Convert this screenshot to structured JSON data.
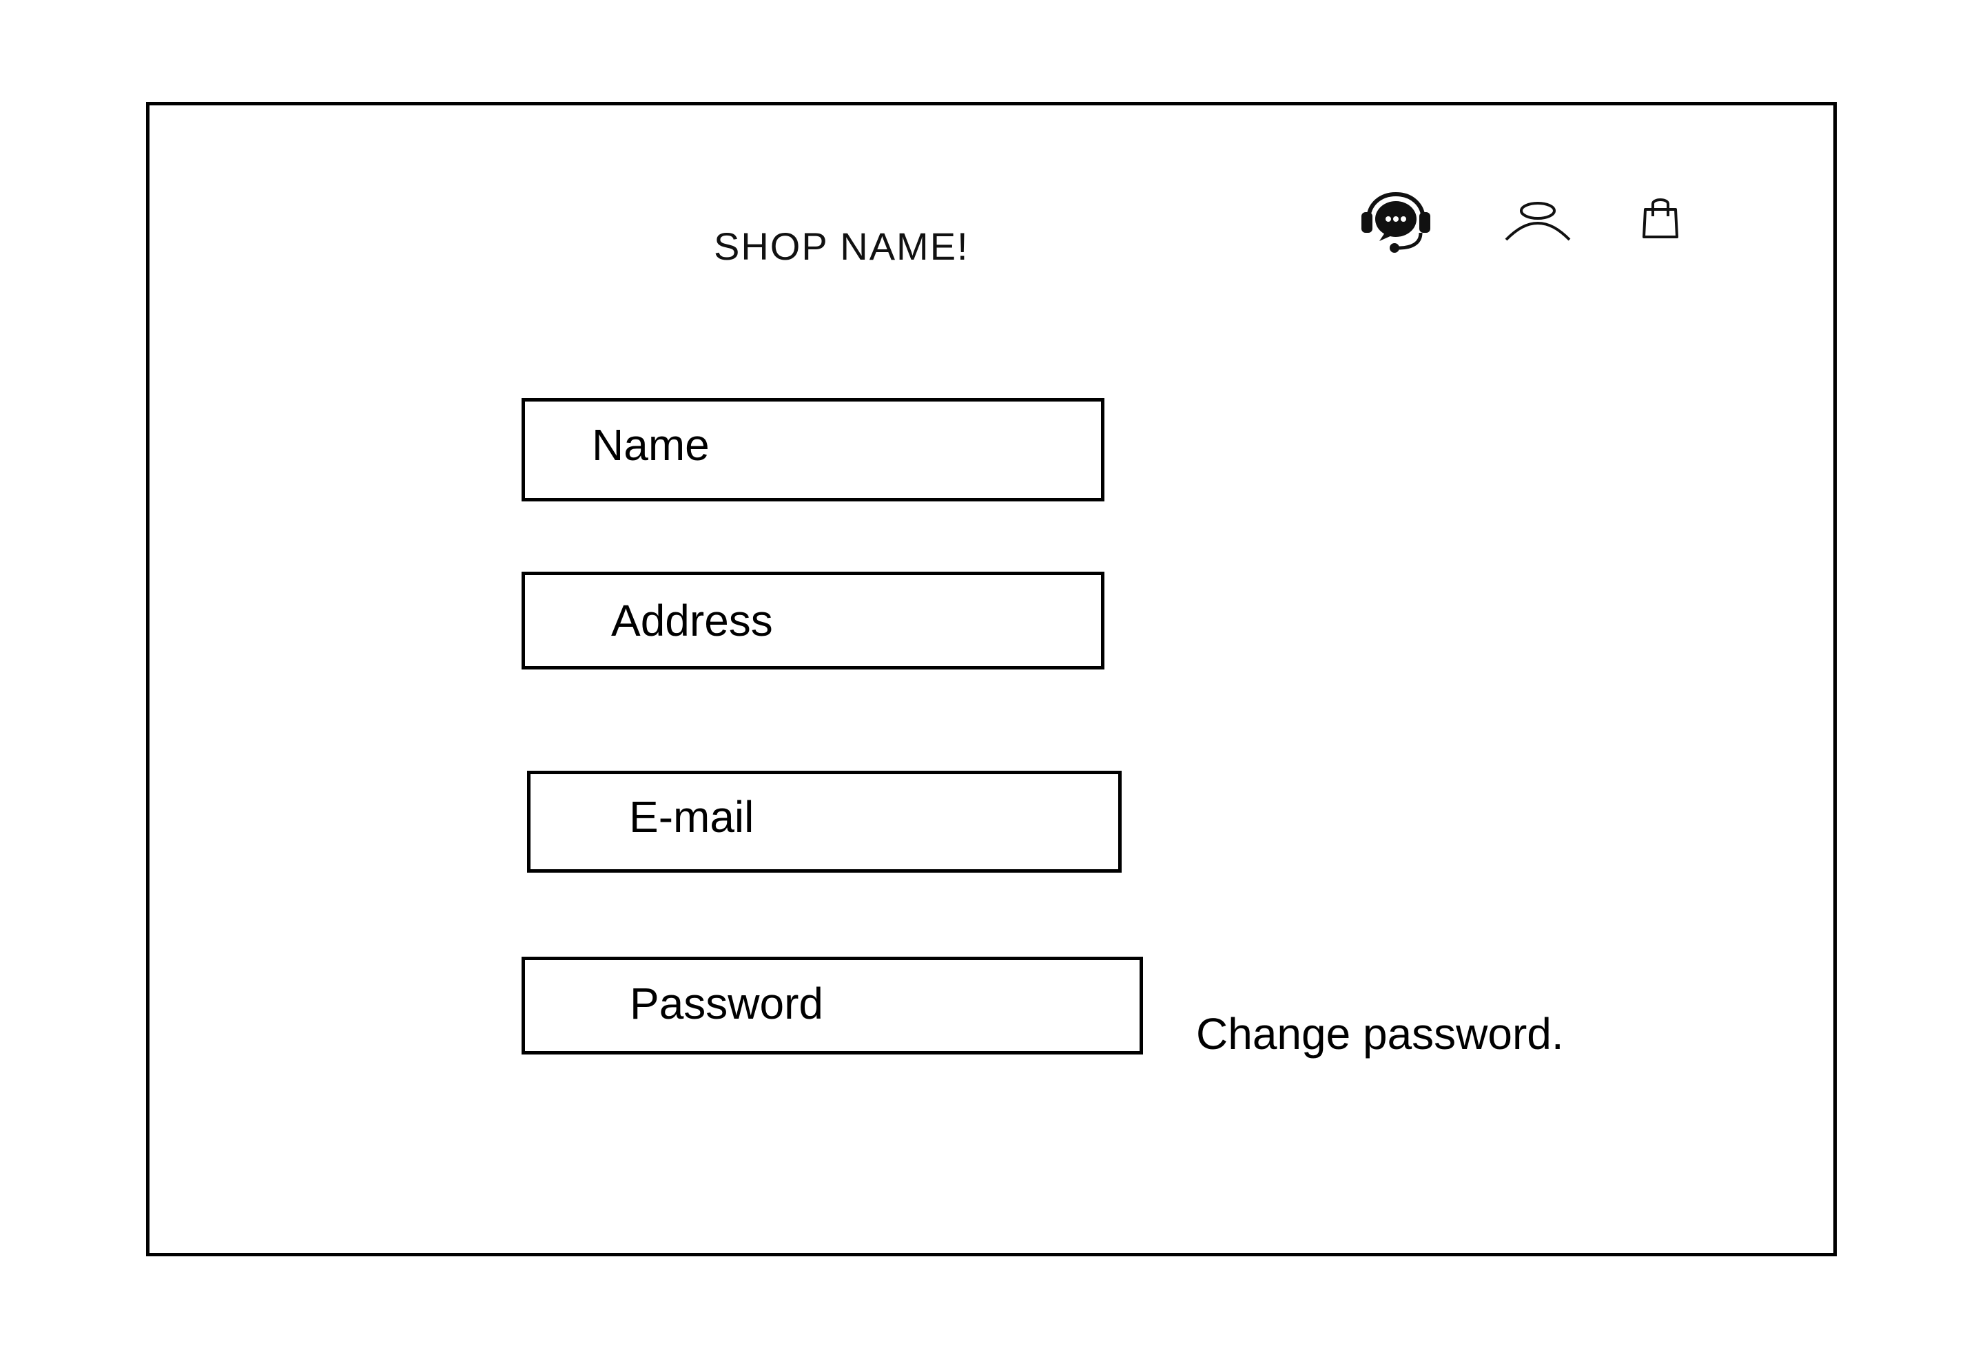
{
  "header": {
    "shop_name": "SHOP NAME!",
    "icons": [
      "support-chat-icon",
      "user-icon",
      "shopping-bag-icon"
    ]
  },
  "form": {
    "name_label": "Name",
    "address_label": "Address",
    "email_label": "E-mail",
    "password_label": "Password",
    "change_password_link": "Change password."
  },
  "colors": {
    "border": "#000000",
    "background": "#ffffff",
    "text": "#000000"
  }
}
